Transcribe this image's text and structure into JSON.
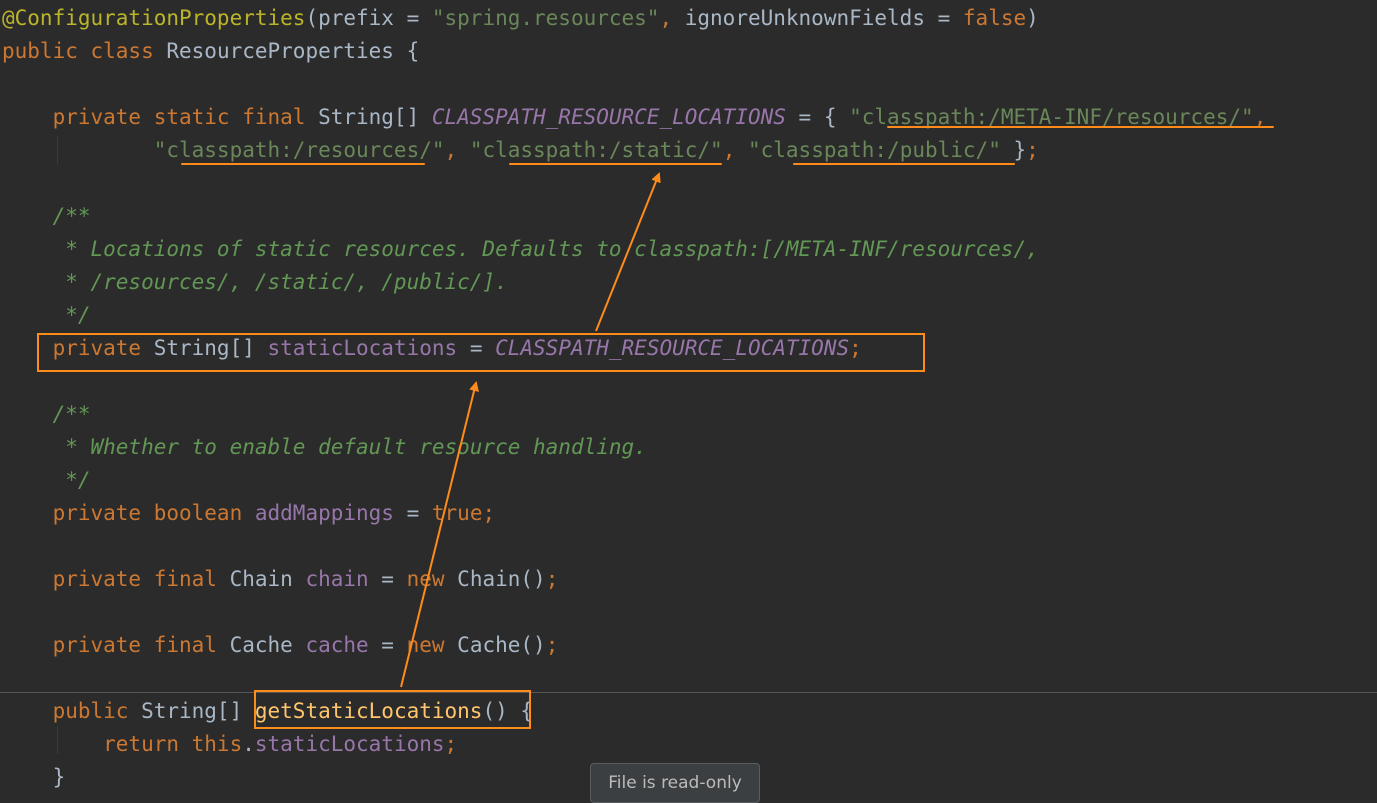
{
  "editor": {
    "theme": "darcula",
    "colors": {
      "background": "#2b2b2b",
      "annotation": "#bbb529",
      "keyword": "#cc7832",
      "string": "#6a8759",
      "field": "#9876aa",
      "doc_comment": "#629755",
      "method": "#ffc66d",
      "plain": "#a9b7c6",
      "highlight_orange": "#ff8c1a"
    },
    "lines": [
      {
        "tokens": [
          {
            "t": "@ConfigurationProperties",
            "c": "ann"
          },
          {
            "t": "(prefix = ",
            "c": "plain"
          },
          {
            "t": "\"spring.resources\"",
            "c": "str"
          },
          {
            "t": ", ",
            "c": "kw"
          },
          {
            "t": "ignoreUnknownFields = ",
            "c": "plain"
          },
          {
            "t": "false",
            "c": "kw"
          },
          {
            "t": ")",
            "c": "plain"
          }
        ]
      },
      {
        "tokens": [
          {
            "t": "public class ",
            "c": "kw"
          },
          {
            "t": "ResourceProperties {",
            "c": "plain"
          }
        ]
      },
      {
        "tokens": []
      },
      {
        "tokens": [
          {
            "t": "    private static final ",
            "c": "kw"
          },
          {
            "t": "String[] ",
            "c": "plain"
          },
          {
            "t": "CLASSPATH_RESOURCE_LOCATIONS",
            "c": "const"
          },
          {
            "t": " = { ",
            "c": "plain"
          },
          {
            "t": "\"classpath:/META-INF/resources/\"",
            "c": "str"
          },
          {
            "t": ",",
            "c": "kw"
          }
        ]
      },
      {
        "tokens": [
          {
            "t": "            ",
            "c": "plain"
          },
          {
            "t": "\"classpath:/resources/\"",
            "c": "str"
          },
          {
            "t": ", ",
            "c": "kw"
          },
          {
            "t": "\"classpath:/static/\"",
            "c": "str"
          },
          {
            "t": ", ",
            "c": "kw"
          },
          {
            "t": "\"classpath:/public/\"",
            "c": "str"
          },
          {
            "t": " }",
            "c": "plain"
          },
          {
            "t": ";",
            "c": "kw"
          }
        ]
      },
      {
        "tokens": []
      },
      {
        "tokens": [
          {
            "t": "    /**",
            "c": "doc"
          }
        ]
      },
      {
        "tokens": [
          {
            "t": "     * Locations of static resources. Defaults to classpath:[/META-INF/resources/,",
            "c": "doc"
          }
        ]
      },
      {
        "tokens": [
          {
            "t": "     * /resources/, /static/, /public/].",
            "c": "doc"
          }
        ]
      },
      {
        "tokens": [
          {
            "t": "     */",
            "c": "doc"
          }
        ]
      },
      {
        "tokens": [
          {
            "t": "    private ",
            "c": "kw"
          },
          {
            "t": "String[] ",
            "c": "plain"
          },
          {
            "t": "staticLocations",
            "c": "field"
          },
          {
            "t": " = ",
            "c": "plain"
          },
          {
            "t": "CLASSPATH_RESOURCE_LOCATIONS",
            "c": "const"
          },
          {
            "t": ";",
            "c": "kw"
          }
        ]
      },
      {
        "tokens": []
      },
      {
        "tokens": [
          {
            "t": "    /**",
            "c": "doc"
          }
        ]
      },
      {
        "tokens": [
          {
            "t": "     * Whether to enable default resource handling.",
            "c": "doc"
          }
        ]
      },
      {
        "tokens": [
          {
            "t": "     */",
            "c": "doc"
          }
        ]
      },
      {
        "tokens": [
          {
            "t": "    private boolean ",
            "c": "kw"
          },
          {
            "t": "addMappings",
            "c": "field"
          },
          {
            "t": " = ",
            "c": "plain"
          },
          {
            "t": "true;",
            "c": "kw"
          }
        ]
      },
      {
        "tokens": []
      },
      {
        "tokens": [
          {
            "t": "    private final ",
            "c": "kw"
          },
          {
            "t": "Chain ",
            "c": "plain"
          },
          {
            "t": "chain",
            "c": "field"
          },
          {
            "t": " = ",
            "c": "plain"
          },
          {
            "t": "new ",
            "c": "kw"
          },
          {
            "t": "Chain()",
            "c": "plain"
          },
          {
            "t": ";",
            "c": "kw"
          }
        ]
      },
      {
        "tokens": []
      },
      {
        "tokens": [
          {
            "t": "    private final ",
            "c": "kw"
          },
          {
            "t": "Cache ",
            "c": "plain"
          },
          {
            "t": "cache",
            "c": "field"
          },
          {
            "t": " = ",
            "c": "plain"
          },
          {
            "t": "new ",
            "c": "kw"
          },
          {
            "t": "Cache()",
            "c": "plain"
          },
          {
            "t": ";",
            "c": "kw"
          }
        ]
      },
      {
        "tokens": []
      },
      {
        "tokens": [
          {
            "t": "    public ",
            "c": "kw"
          },
          {
            "t": "String[] ",
            "c": "plain"
          },
          {
            "t": "getStaticLocations",
            "c": "method"
          },
          {
            "t": "() {",
            "c": "plain"
          }
        ]
      },
      {
        "tokens": [
          {
            "t": "        return this",
            "c": "kw"
          },
          {
            "t": ".",
            "c": "plain"
          },
          {
            "t": "staticLocations",
            "c": "field"
          },
          {
            "t": ";",
            "c": "kw"
          }
        ]
      },
      {
        "tokens": [
          {
            "t": "    }",
            "c": "plain"
          }
        ]
      }
    ]
  },
  "tooltip": {
    "text": "File is read-only"
  }
}
